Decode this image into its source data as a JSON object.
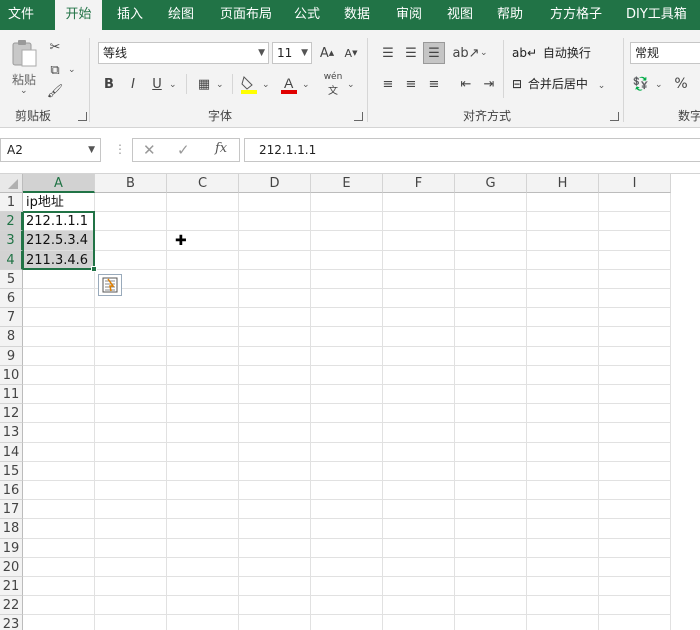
{
  "tabs": [
    {
      "label": "文件",
      "active": false
    },
    {
      "label": "开始",
      "active": true
    },
    {
      "label": "插入",
      "active": false
    },
    {
      "label": "绘图",
      "active": false
    },
    {
      "label": "页面布局",
      "active": false
    },
    {
      "label": "公式",
      "active": false
    },
    {
      "label": "数据",
      "active": false
    },
    {
      "label": "审阅",
      "active": false
    },
    {
      "label": "视图",
      "active": false
    },
    {
      "label": "帮助",
      "active": false
    },
    {
      "label": "方方格子",
      "active": false
    },
    {
      "label": "DIY工具箱",
      "active": false
    }
  ],
  "ribbon": {
    "clipboard": {
      "label": "剪贴板",
      "paste_label": "粘贴"
    },
    "font": {
      "label": "字体",
      "font_name": "等线",
      "font_size": "11",
      "bold": "B",
      "italic": "I",
      "underline": "U",
      "phonetic": "wén"
    },
    "alignment": {
      "label": "对齐方式",
      "wrap_text": "自动换行",
      "merge_center": "合并后居中"
    },
    "number": {
      "label": "数字",
      "format": "常规",
      "percent": "%"
    }
  },
  "formula_bar": {
    "name_box": "A2",
    "fx": "fx",
    "content": "212.1.1.1"
  },
  "columns": [
    "A",
    "B",
    "C",
    "D",
    "E",
    "F",
    "G",
    "H",
    "I"
  ],
  "rows": [
    "1",
    "2",
    "3",
    "4",
    "5",
    "6",
    "7",
    "8",
    "9",
    "10",
    "11",
    "12",
    "13",
    "14",
    "15",
    "16",
    "17",
    "18",
    "19",
    "20",
    "21",
    "22",
    "23"
  ],
  "cells": {
    "A1": "ip地址",
    "A2": "212.1.1.1",
    "A3": "212.5.3.4",
    "A4": "211.3.4.6"
  },
  "colors": {
    "accent": "#217346",
    "selection": "#d2d2d2"
  }
}
